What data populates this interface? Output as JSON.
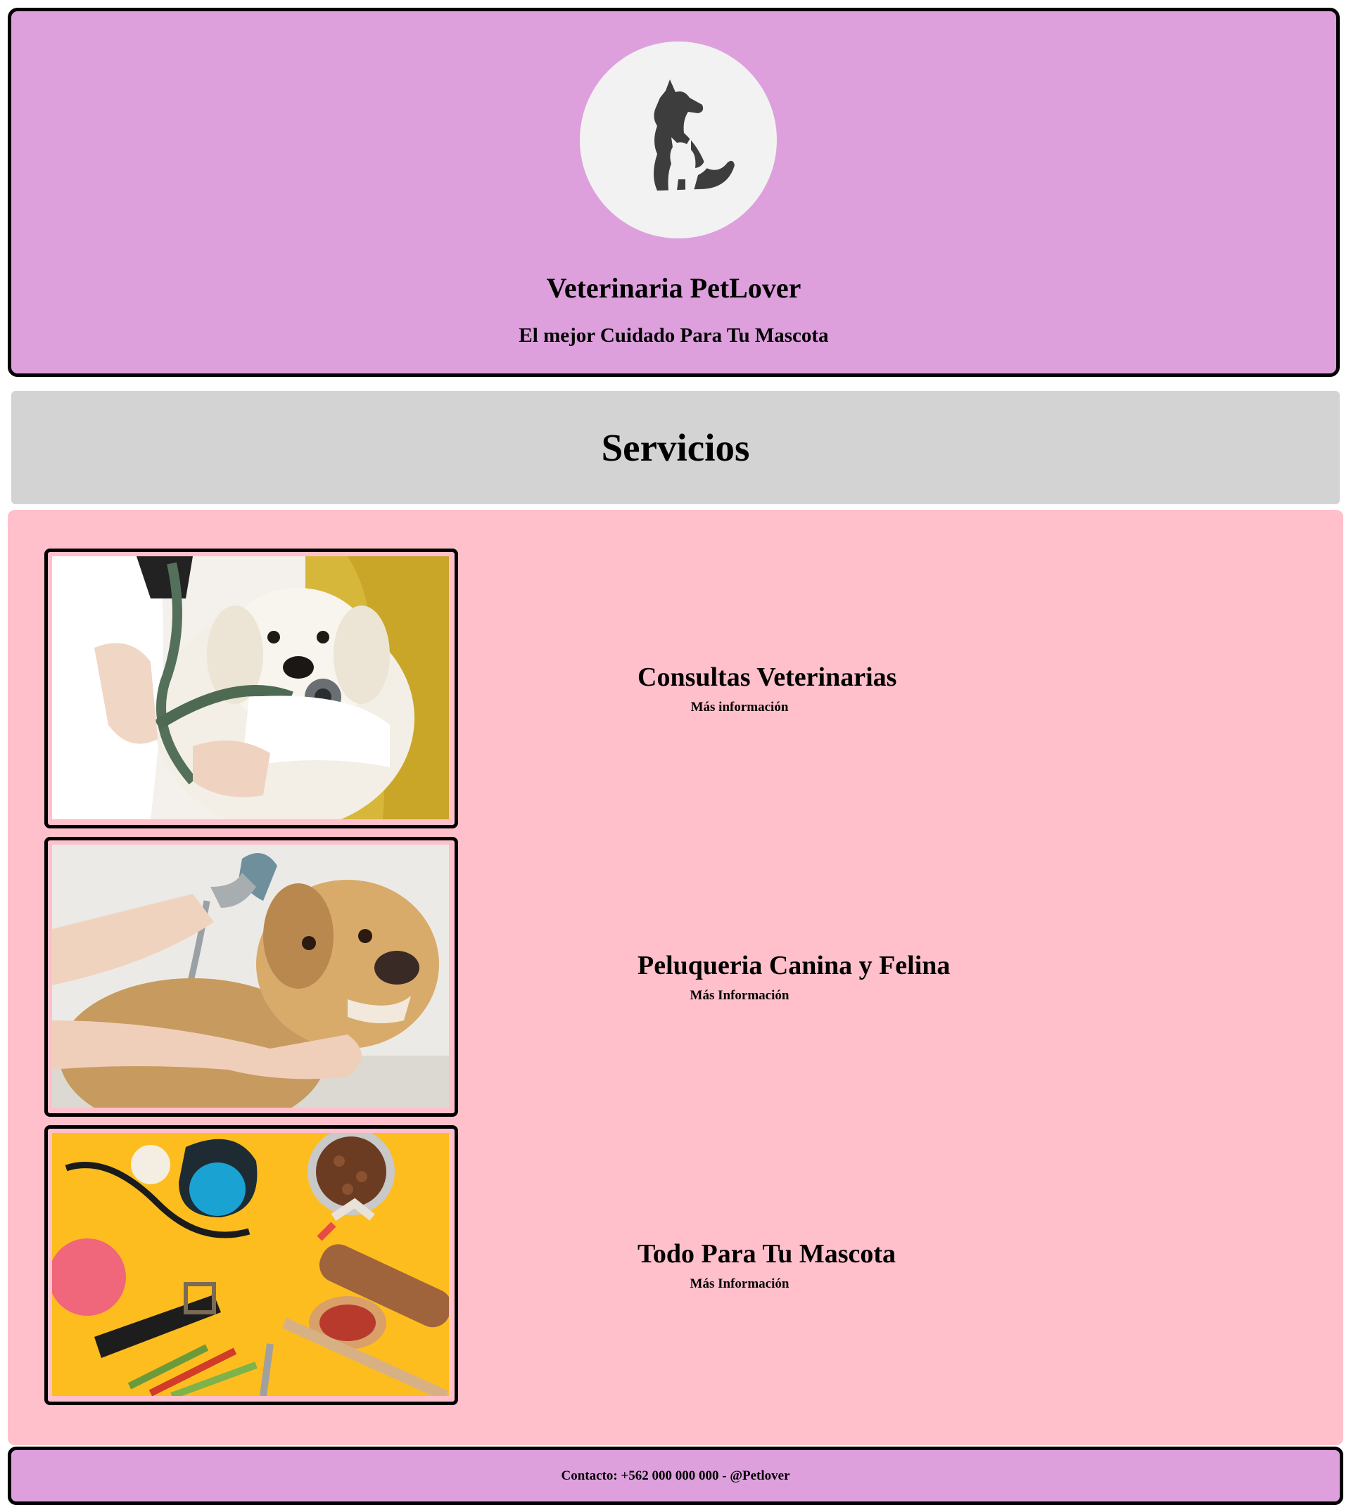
{
  "header": {
    "logo_icon": "dog-and-cat-silhouette-icon",
    "title": "Veterinaria PetLover",
    "tagline": "El mejor Cuidado Para Tu Mascota"
  },
  "section": {
    "title": "Servicios"
  },
  "services": [
    {
      "image": "vet-holding-puppy-with-stethoscope-photo",
      "title": "Consultas Veterinarias",
      "link": "Más información"
    },
    {
      "image": "dog-getting-shower-bath-photo",
      "title": "Peluqueria Canina y Felina",
      "link": "Más Información"
    },
    {
      "image": "pet-supplies-flatlay-photo",
      "title": "Todo Para Tu Mascota",
      "link": "Más Información"
    }
  ],
  "footer": {
    "text": "Contacto: +562 000 000 000 - @Petlover"
  },
  "colors": {
    "header_bg": "#dda0dd",
    "section_bar_bg": "#d3d3d3",
    "services_bg": "#ffc0cb",
    "footer_bg": "#dda0dd"
  }
}
